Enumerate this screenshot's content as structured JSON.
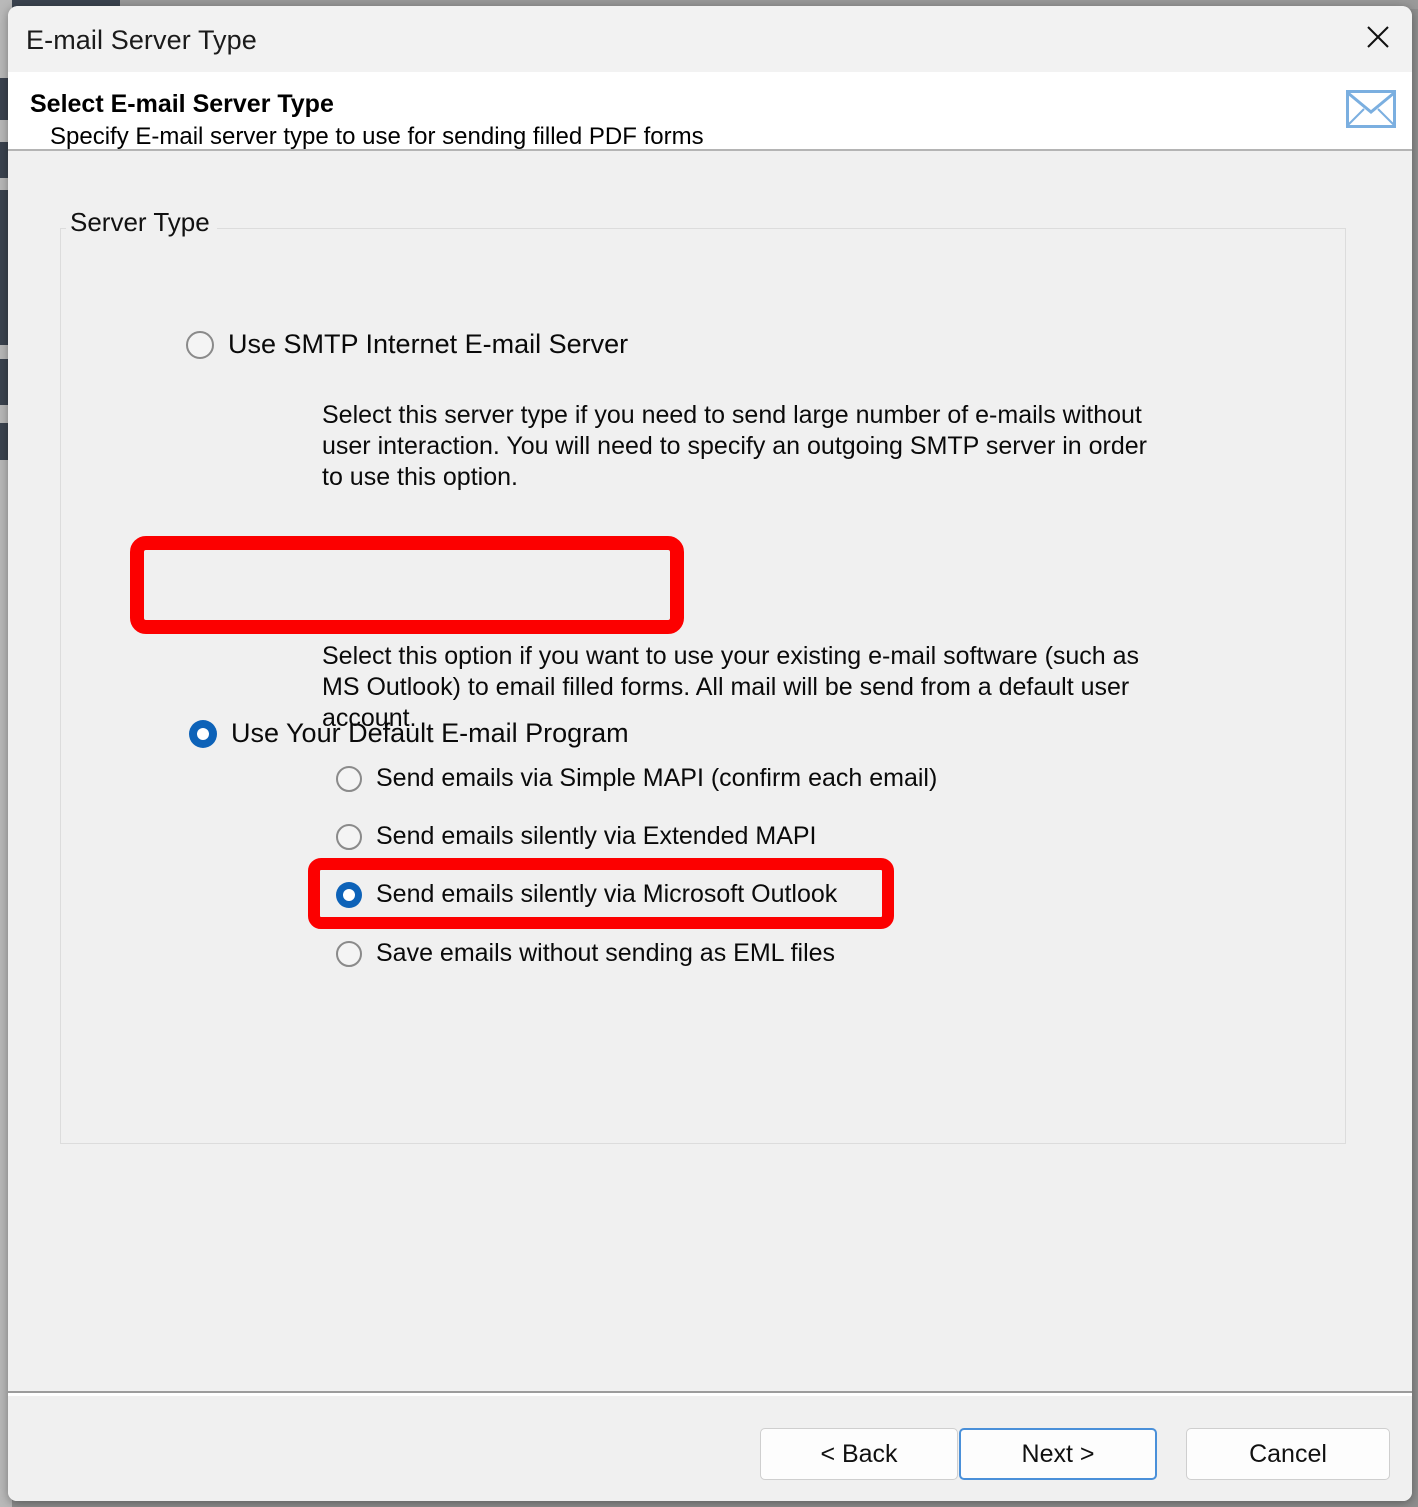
{
  "window": {
    "title": "E-mail Server Type",
    "close_icon": "close-icon"
  },
  "header": {
    "title": "Select E-mail Server Type",
    "subtitle": "Specify E-mail server type to use for sending filled PDF forms",
    "icon": "envelope-icon",
    "icon_color": "#7bafe0"
  },
  "group": {
    "legend": "Server Type"
  },
  "options": {
    "smtp": {
      "label": "Use SMTP Internet E-mail Server",
      "selected": false,
      "description": "Select this server type if you need to send large number of e-mails without user interaction. You will need to specify an outgoing SMTP server in order to use this option."
    },
    "default_program": {
      "label": "Use Your Default E-mail Program",
      "selected": true,
      "highlighted": true,
      "description": "Select this option if you want to use your existing e-mail software (such as MS Outlook) to email filled forms. All mail will be send from a default user account."
    },
    "sub_options": [
      {
        "label": "Send emails via Simple MAPI (confirm each email)",
        "selected": false,
        "highlighted": false
      },
      {
        "label": "Send emails silently via Extended MAPI",
        "selected": false,
        "highlighted": false
      },
      {
        "label": "Send emails silently via Microsoft Outlook",
        "selected": true,
        "highlighted": true
      },
      {
        "label": "Save emails without sending as EML files",
        "selected": false,
        "highlighted": false
      }
    ]
  },
  "footer": {
    "back_label": "< Back",
    "next_label": "Next >",
    "cancel_label": "Cancel"
  },
  "annotation": {
    "color": "#fc0000"
  }
}
